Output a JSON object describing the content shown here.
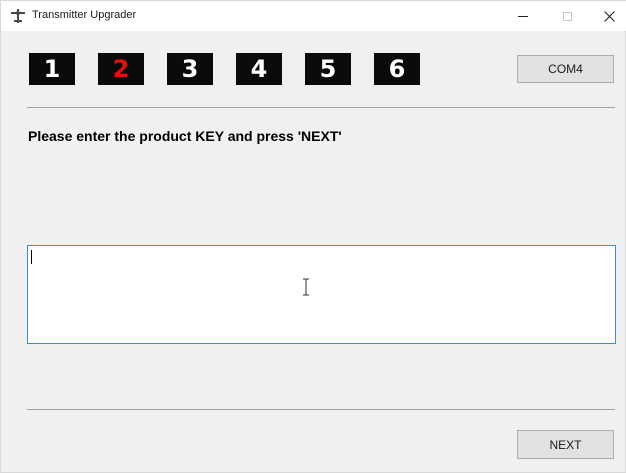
{
  "window": {
    "title": "Transmitter Upgrader",
    "icon": "airplane-icon",
    "controls": [
      "minimize-icon",
      "maximize-icon",
      "close-icon"
    ]
  },
  "steps": [
    {
      "label": "1",
      "active": false
    },
    {
      "label": "2",
      "active": true
    },
    {
      "label": "3",
      "active": false
    },
    {
      "label": "4",
      "active": false
    },
    {
      "label": "5",
      "active": false
    },
    {
      "label": "6",
      "active": false
    }
  ],
  "com_button": {
    "label": "COM4"
  },
  "instruction": "Please enter the product KEY and press 'NEXT'",
  "key_input": {
    "value": "",
    "placeholder": ""
  },
  "next_button": {
    "label": "NEXT"
  },
  "colors": {
    "active_step": "#e01010",
    "step_text": "#ffffff",
    "step_bg": "#0b0b0b",
    "input_focus_border": "#3c8ad8"
  }
}
